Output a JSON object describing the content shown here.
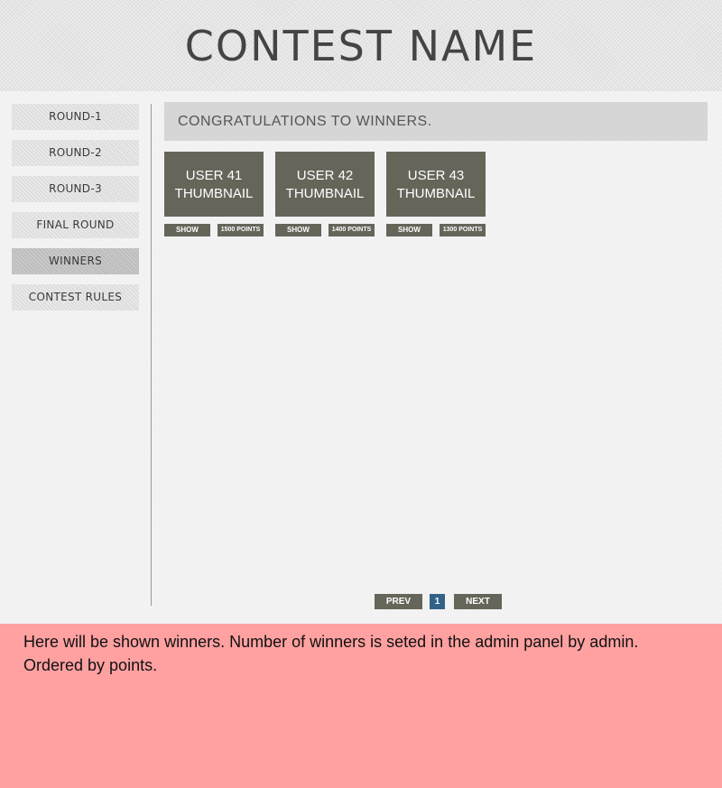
{
  "header": {
    "title": "CONTEST  NAME"
  },
  "sidebar": {
    "items": [
      {
        "label": "ROUND-1"
      },
      {
        "label": "ROUND-2"
      },
      {
        "label": "ROUND-3"
      },
      {
        "label": "FINAL  ROUND"
      },
      {
        "label": "WINNERS",
        "active": true
      },
      {
        "label": "CONTEST  RULES"
      }
    ]
  },
  "main": {
    "banner": "CONGRATULATIONS TO WINNERS.",
    "winners": [
      {
        "line1": "USER 41",
        "line2": "THUMBNAIL",
        "show_label": "SHOW",
        "points": "1500 POINTS"
      },
      {
        "line1": "USER 42",
        "line2": "THUMBNAIL",
        "show_label": "SHOW",
        "points": "1400 POINTS"
      },
      {
        "line1": "USER 43",
        "line2": "THUMBNAIL",
        "show_label": "SHOW",
        "points": "1300 POINTS"
      }
    ]
  },
  "pagination": {
    "prev": "PREV",
    "current": "1",
    "next": "NEXT"
  },
  "note": "Here will be shown winners. Number of winners is seted in the admin panel by admin.  Ordered by points.",
  "colors": {
    "tile": "#66655a",
    "page_active": "#336288",
    "note_bg": "#ffa1a1",
    "banner_bg": "#d6d6d6"
  }
}
